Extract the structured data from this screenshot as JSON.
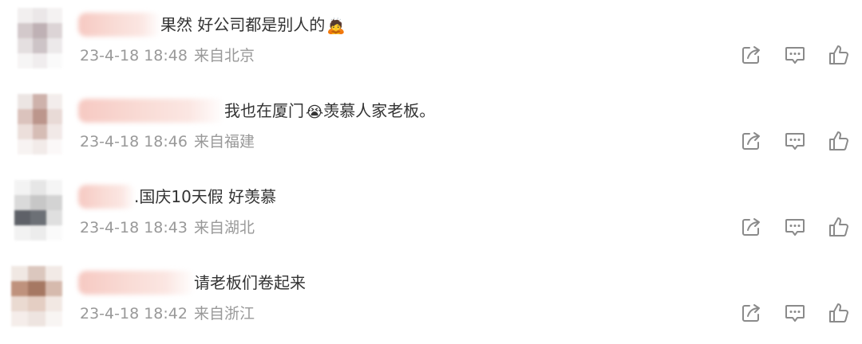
{
  "comments": [
    {
      "text": "果然 好公司都是别人的",
      "emoji": "🙇",
      "date": "23-4-18 18:48",
      "location": "来自北京"
    },
    {
      "text": "我也在厦门",
      "emoji": "😭",
      "text_after": "羡慕人家老板。",
      "date": "23-4-18 18:46",
      "location": "来自福建"
    },
    {
      "text": ".国庆10天假  好羡慕",
      "date": "23-4-18 18:43",
      "location": "来自湖北"
    },
    {
      "text": "请老板们卷起来",
      "date": "23-4-18 18:42",
      "location": "来自浙江"
    }
  ],
  "actions": {
    "share_icon": "share-icon",
    "comment_icon": "comment-icon",
    "like_icon": "thumbs-up-icon"
  },
  "colors": {
    "text": "#333333",
    "meta": "#999999",
    "icon": "#8a8a8a"
  }
}
